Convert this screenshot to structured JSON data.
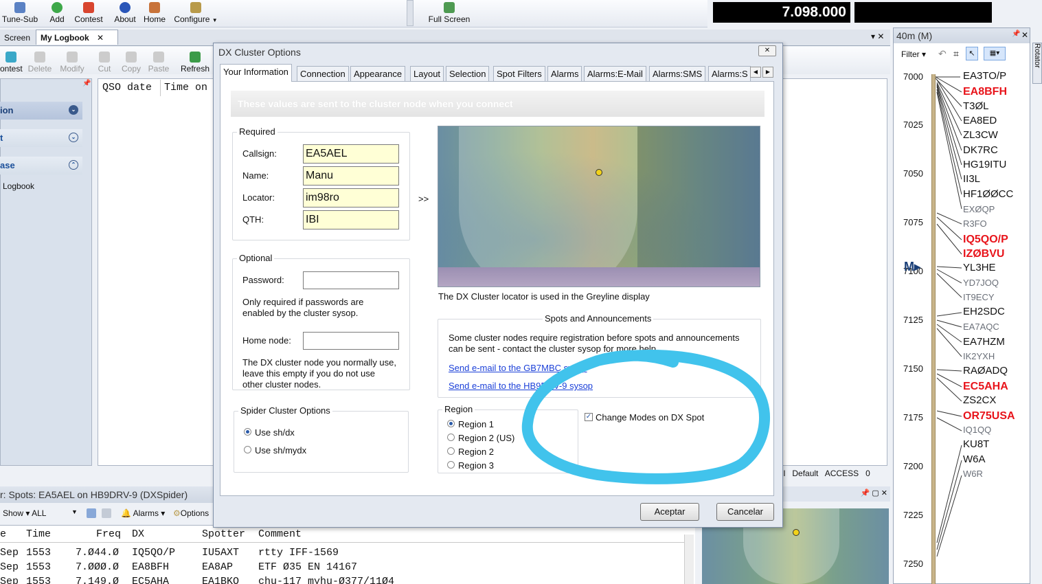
{
  "toolbar": {
    "tune_sub": "Tune-Sub",
    "add": "Add",
    "contest": "Contest",
    "about": "About",
    "home": "Home",
    "configure": "Configure",
    "full_screen": "Full Screen"
  },
  "frequency_display": "7.098.000",
  "doc_tabs": {
    "screen": "Screen",
    "my_logbook": "My Logbook"
  },
  "subtoolbar": {
    "contest": "ontest",
    "delete": "Delete",
    "modify": "Modify",
    "cut": "Cut",
    "copy": "Copy",
    "paste": "Paste",
    "refresh": "Refresh"
  },
  "nav": {
    "item1": "ion",
    "item2": "t",
    "item3": "ase",
    "logbook": "Logbook"
  },
  "grid_headers": {
    "qso_date": "QSO date",
    "time_on": "Time on"
  },
  "dialog": {
    "title": "DX Cluster Options",
    "tabs": [
      "Your Information",
      "Connection",
      "Appearance",
      "Layout",
      "Selection",
      "Spot Filters",
      "Alarms",
      "Alarms:E-Mail",
      "Alarms:SMS",
      "Alarms:S"
    ],
    "banner": "These values are sent to the cluster node when you connect",
    "required": {
      "legend": "Required",
      "callsign_label": "Callsign:",
      "callsign": "EA5AEL",
      "name_label": "Name:",
      "name": "Manu",
      "locator_label": "Locator:",
      "locator": "im98ro",
      "qth_label": "QTH:",
      "qth": "IBI"
    },
    "arrow": ">>",
    "optional": {
      "legend": "Optional",
      "password_label": "Password:",
      "password_note_1": "Only required if passwords are",
      "password_note_2": "enabled by the cluster sysop.",
      "home_node_label": "Home node:",
      "home_note_1": "The DX cluster node you normally use,",
      "home_note_2": "leave this empty if you do not use",
      "home_note_3": "other cluster nodes."
    },
    "map_caption": "The DX Cluster locator is used in the Greyline display",
    "spots": {
      "legend": "Spots and Announcements",
      "text_1": "Some cluster nodes require registration before spots and announcements",
      "text_2": "can be sent - contact the cluster sysop for more help.",
      "link_1": "Send e-mail to the GB7MBC sysop",
      "link_2": "Send e-mail to the HB9DRV-9 sysop"
    },
    "spider": {
      "legend": "Spider Cluster Options",
      "opt1": "Use sh/dx",
      "opt2": "Use sh/mydx"
    },
    "region": {
      "legend": "Region",
      "r1": "Region 1",
      "r2": "Region 2 (US)",
      "r3": "Region 2",
      "r4": "Region 3"
    },
    "change_modes": "Change Modes on DX Spot",
    "ok": "Aceptar",
    "cancel": "Cancelar"
  },
  "spots_panel": {
    "title": "r: Spots: EA5AEL on HB9DRV-9 (DXSpider)",
    "show": "Show",
    "filter_value": "ALL",
    "alarms": "Alarms",
    "options": "Options",
    "headers": [
      "e",
      "Time",
      "Freq",
      "DX",
      "Spotter",
      "Comment"
    ],
    "rows": [
      [
        "Sep",
        "1553",
        "7.Ø44.Ø",
        "IQ5QO/P",
        "IU5AXT",
        "rtty IFF-1569"
      ],
      [
        "Sep",
        "1553",
        "7.ØØØ.Ø",
        "EA8BFH",
        "EA8AP",
        "ETF Ø35 EN 14167"
      ],
      [
        "Sep",
        "1553",
        "7.149.Ø",
        "EC5AHA",
        "EA1BKO",
        "chu-117 myhu-Ø377/11Ø4"
      ]
    ]
  },
  "status_bar": {
    "all": "All",
    "default": "Default",
    "access": "ACCESS",
    "count": "0"
  },
  "band_panel": {
    "title": "40m (M)",
    "filter": "Filter",
    "rotator": "Rotator",
    "marker": "M",
    "freq_labels": [
      "7000",
      "7025",
      "7050",
      "7075",
      "7100",
      "7125",
      "7150",
      "7175",
      "7200",
      "7225",
      "7250"
    ],
    "spots": [
      {
        "call": "EA3TO/P",
        "style": "normal"
      },
      {
        "call": "EA8BFH",
        "style": "red"
      },
      {
        "call": "T3ØL",
        "style": "normal"
      },
      {
        "call": "EA8ED",
        "style": "normal"
      },
      {
        "call": "ZL3CW",
        "style": "normal"
      },
      {
        "call": "DK7RC",
        "style": "normal"
      },
      {
        "call": "HG19ITU",
        "style": "normal"
      },
      {
        "call": "II3L",
        "style": "normal"
      },
      {
        "call": "HF1ØØCC",
        "style": "normal"
      },
      {
        "call": "EXØQP",
        "style": "gray"
      },
      {
        "call": "R3FO",
        "style": "gray"
      },
      {
        "call": "IQ5QO/P",
        "style": "red"
      },
      {
        "call": "IZØBVU",
        "style": "red"
      },
      {
        "call": "YL3HE",
        "style": "normal"
      },
      {
        "call": "YD7JOQ",
        "style": "gray"
      },
      {
        "call": "IT9ECY",
        "style": "gray"
      },
      {
        "call": "EH2SDC",
        "style": "normal"
      },
      {
        "call": "EA7AQC",
        "style": "gray"
      },
      {
        "call": "EA7HZM",
        "style": "normal"
      },
      {
        "call": "IK2YXH",
        "style": "gray"
      },
      {
        "call": "RAØADQ",
        "style": "normal"
      },
      {
        "call": "EC5AHA",
        "style": "red"
      },
      {
        "call": "ZS2CX",
        "style": "normal"
      },
      {
        "call": "OR75USA",
        "style": "red"
      },
      {
        "call": "IQ1QQ",
        "style": "gray"
      },
      {
        "call": "KU8T",
        "style": "normal"
      },
      {
        "call": "W6A",
        "style": "normal"
      },
      {
        "call": "W6R",
        "style": "gray"
      }
    ]
  },
  "colors": {
    "accent": "#1a60c8",
    "spot_red": "#e8141b",
    "annotation": "#41c3ec"
  }
}
